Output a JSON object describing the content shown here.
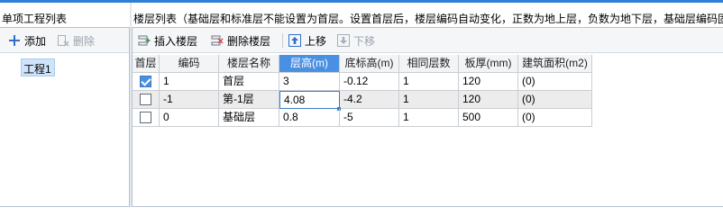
{
  "left_panel": {
    "title": "单项工程列表",
    "toolbar": {
      "add_label": "添加",
      "delete_label": "删除"
    },
    "tree": [
      {
        "label": "工程1"
      }
    ]
  },
  "right_panel": {
    "title": "楼层列表（基础层和标准层不能设置为首层。设置首层后，楼层编码自动变化，正数为地上层，负数为地下层，基础层编码固",
    "toolbar": {
      "insert_label": "插入楼层",
      "delete_label": "删除楼层",
      "up_label": "上移",
      "down_label": "下移"
    },
    "table": {
      "headers": [
        "首层",
        "编码",
        "楼层名称",
        "层高(m)",
        "底标高(m)",
        "相同层数",
        "板厚(mm)",
        "建筑面积(m2)"
      ],
      "rows": [
        {
          "first": true,
          "code": "1",
          "name": "首层",
          "height": "3",
          "bottom": "-0.12",
          "same": "1",
          "thickness": "120",
          "area": "(0)"
        },
        {
          "first": false,
          "code": "-1",
          "name": "第-1层",
          "height": "4.08",
          "bottom": "-4.2",
          "same": "1",
          "thickness": "120",
          "area": "(0)"
        },
        {
          "first": false,
          "code": "0",
          "name": "基础层",
          "height": "0.8",
          "bottom": "-5",
          "same": "1",
          "thickness": "500",
          "area": "(0)"
        }
      ]
    }
  },
  "colors": {
    "accent": "#4a90e2",
    "topline": "#2f7fd8",
    "selected_tree": "#cfe3fa"
  }
}
